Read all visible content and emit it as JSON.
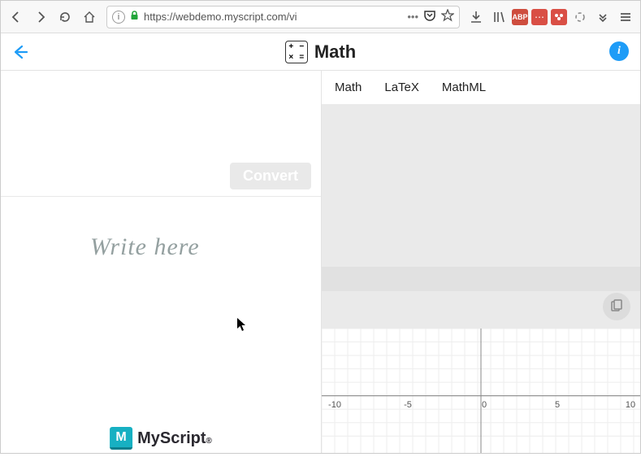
{
  "browser": {
    "url": "https://webdemo.myscript.com/vi",
    "url_display_faded": "…"
  },
  "header": {
    "title": "Math"
  },
  "left": {
    "convert_label": "Convert",
    "placeholder_text": "Write here",
    "brand_name": "MyScript"
  },
  "right": {
    "tabs": [
      "Math",
      "LaTeX",
      "MathML"
    ]
  },
  "chart_data": {
    "type": "line",
    "x_ticks": [
      -10,
      -5,
      0,
      5,
      10
    ],
    "xlim": [
      -12,
      12
    ],
    "ylim": [
      -2,
      3
    ],
    "series": []
  }
}
